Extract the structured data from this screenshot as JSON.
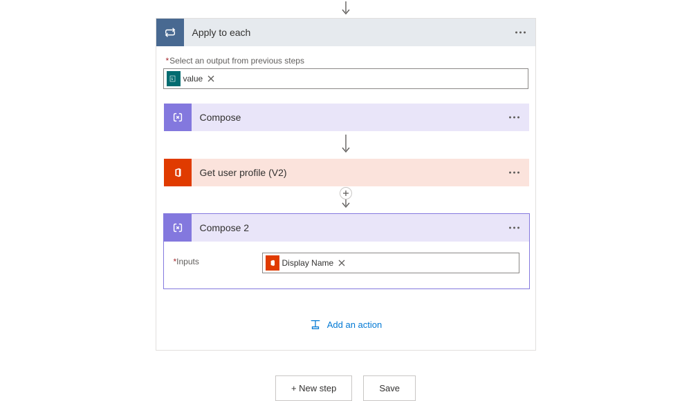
{
  "colors": {
    "apply_each": "#486991",
    "compose": "#8378de",
    "office": "#e03b00",
    "link": "#0078d4"
  },
  "apply_each": {
    "title": "Apply to each",
    "select_label": "Select an output from previous steps",
    "token": {
      "icon_label": "s",
      "text": "value"
    }
  },
  "compose": {
    "title": "Compose"
  },
  "get_user": {
    "title": "Get user profile (V2)"
  },
  "compose2": {
    "title": "Compose 2",
    "inputs_label": "Inputs",
    "token": {
      "text": "Display Name"
    }
  },
  "add_action_label": "Add an action",
  "buttons": {
    "new_step": "+ New step",
    "save": "Save"
  }
}
